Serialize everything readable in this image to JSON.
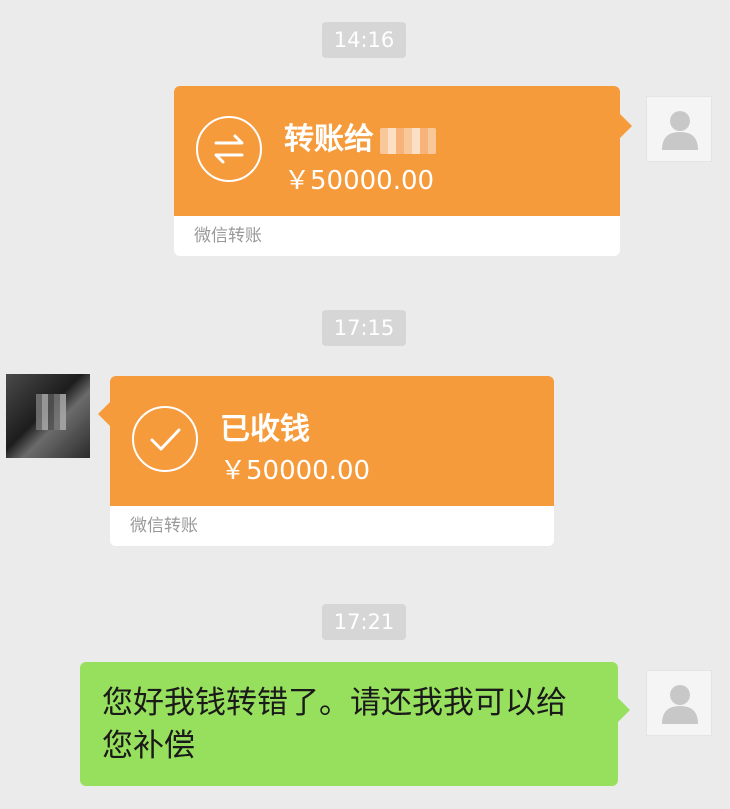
{
  "messages": {
    "time1": "14:16",
    "transfer_out": {
      "title": "转账给",
      "amount": "￥50000.00",
      "footer": "微信转账"
    },
    "time2": "17:15",
    "transfer_received": {
      "title": "已收钱",
      "amount": "￥50000.00",
      "footer": "微信转账"
    },
    "time3": "17:21",
    "text_message": "您好我钱转错了。请还我我可以给您补偿"
  },
  "colors": {
    "transfer_orange": "#f69b3c",
    "sent_green": "#97e05d",
    "background": "#ebebeb"
  }
}
